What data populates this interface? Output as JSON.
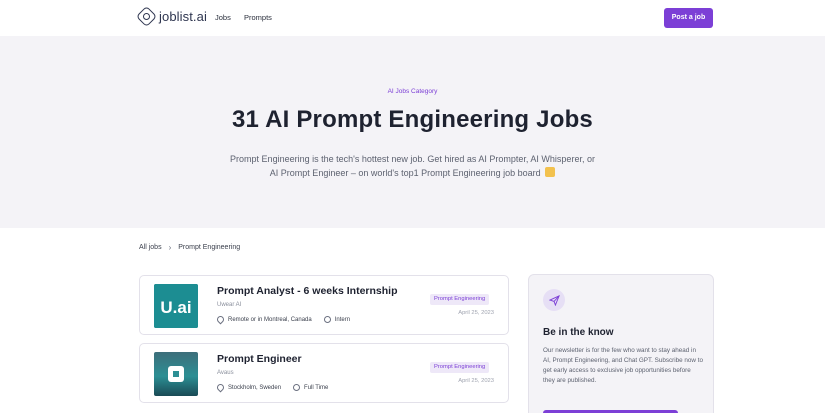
{
  "nav": {
    "logo": "joblist.ai",
    "links": [
      "Jobs",
      "Prompts"
    ],
    "post_button": "Post a job"
  },
  "hero": {
    "eyebrow": "AI Jobs Category",
    "title": "31 AI Prompt Engineering Jobs",
    "description": "Prompt Engineering is the tech's hottest new job. Get hired as AI Prompter, AI Whisperer, or AI Prompt Engineer – on world's top1 Prompt Engineering job board"
  },
  "breadcrumb": [
    "All jobs",
    "Prompt Engineering"
  ],
  "jobs": [
    {
      "title": "Prompt Analyst - 6 weeks Internship",
      "company": "Uwear AI",
      "location": "Remote or in Montreal, Canada",
      "type": "Intern",
      "tag": "Prompt Engineering",
      "date": "April 25, 2023",
      "logo_text": "U.ai"
    },
    {
      "title": "Prompt Engineer",
      "company": "Avaus",
      "location": "Stockholm, Sweden",
      "type": "Full Time",
      "tag": "Prompt Engineering",
      "date": "April 25, 2023",
      "logo_text": ""
    }
  ],
  "newsletter": {
    "title": "Be in the know",
    "description": "Our newsletter is for the few who want to stay ahead in AI, Prompt Engineering, and Chat GPT. Subscribe now to get early access to exclusive job opportunities before they are published."
  },
  "colors": {
    "accent": "#7c3fd6",
    "hero_bg": "#f4f3f7"
  },
  "icons": [
    "logo-icon",
    "chevron-right-icon",
    "location-pin-icon",
    "clock-icon",
    "send-icon"
  ]
}
